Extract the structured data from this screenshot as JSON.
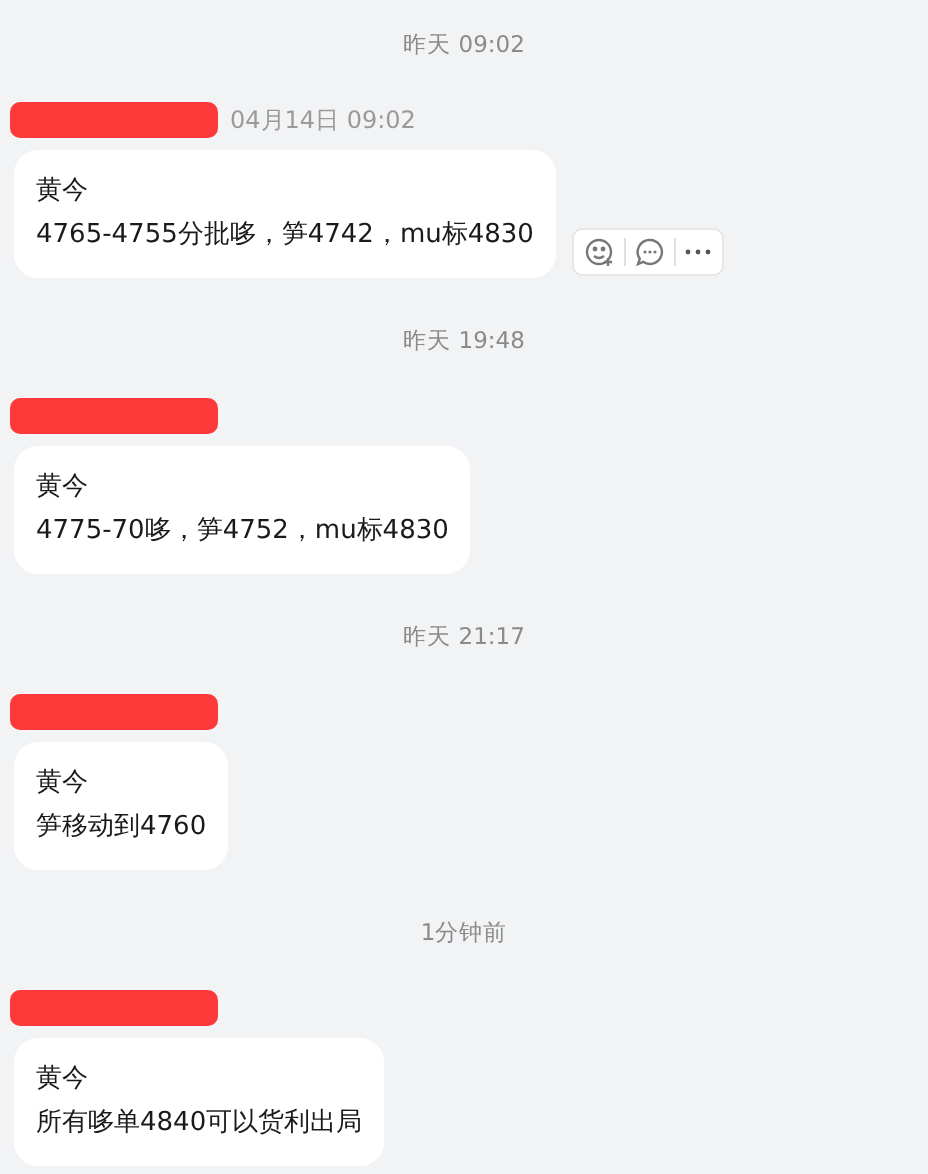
{
  "messages": [
    {
      "time_divider": "昨天 09:02",
      "sender_time": "04月14日 09:02",
      "sender": "黄今",
      "text": "4765-4755分批哆，笋4742，mu标4830",
      "hovered": true
    },
    {
      "time_divider": "昨天 19:48",
      "sender": "黄今",
      "text": "4775-70哆，笋4752，mu标4830",
      "hovered": false
    },
    {
      "time_divider": "昨天 21:17",
      "sender": "黄今",
      "text": "笋移动到4760",
      "hovered": false
    },
    {
      "time_divider": "1分钟前",
      "sender": "黄今",
      "text": "所有哆单4840可以货利出局",
      "hovered": false
    }
  ]
}
